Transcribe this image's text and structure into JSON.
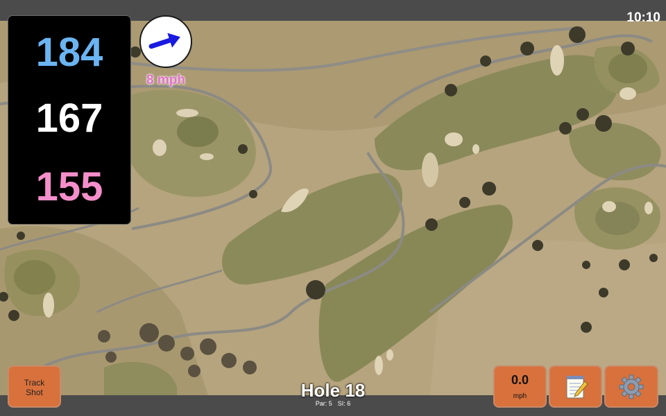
{
  "status_bar": {
    "time": "10:10"
  },
  "distances": {
    "back": "184",
    "middle": "167",
    "front": "155"
  },
  "wind": {
    "speed_label": "8 mph",
    "direction_icon": "wind-arrow-icon",
    "direction_degrees": -18
  },
  "buttons": {
    "track_shot_line1": "Track",
    "track_shot_line2": "Shot",
    "wind_value": "0.0",
    "wind_unit": "mph",
    "notes_icon": "notepad-icon",
    "settings_icon": "gear-icon"
  },
  "hole": {
    "title": "Hole 18",
    "par": "Par: 5",
    "si": "SI: 6"
  },
  "colors": {
    "back": "#6bb4f2",
    "middle": "#ffffff",
    "front": "#f58fcb",
    "button": "#d8713c",
    "wind_text": "#e271c9"
  }
}
